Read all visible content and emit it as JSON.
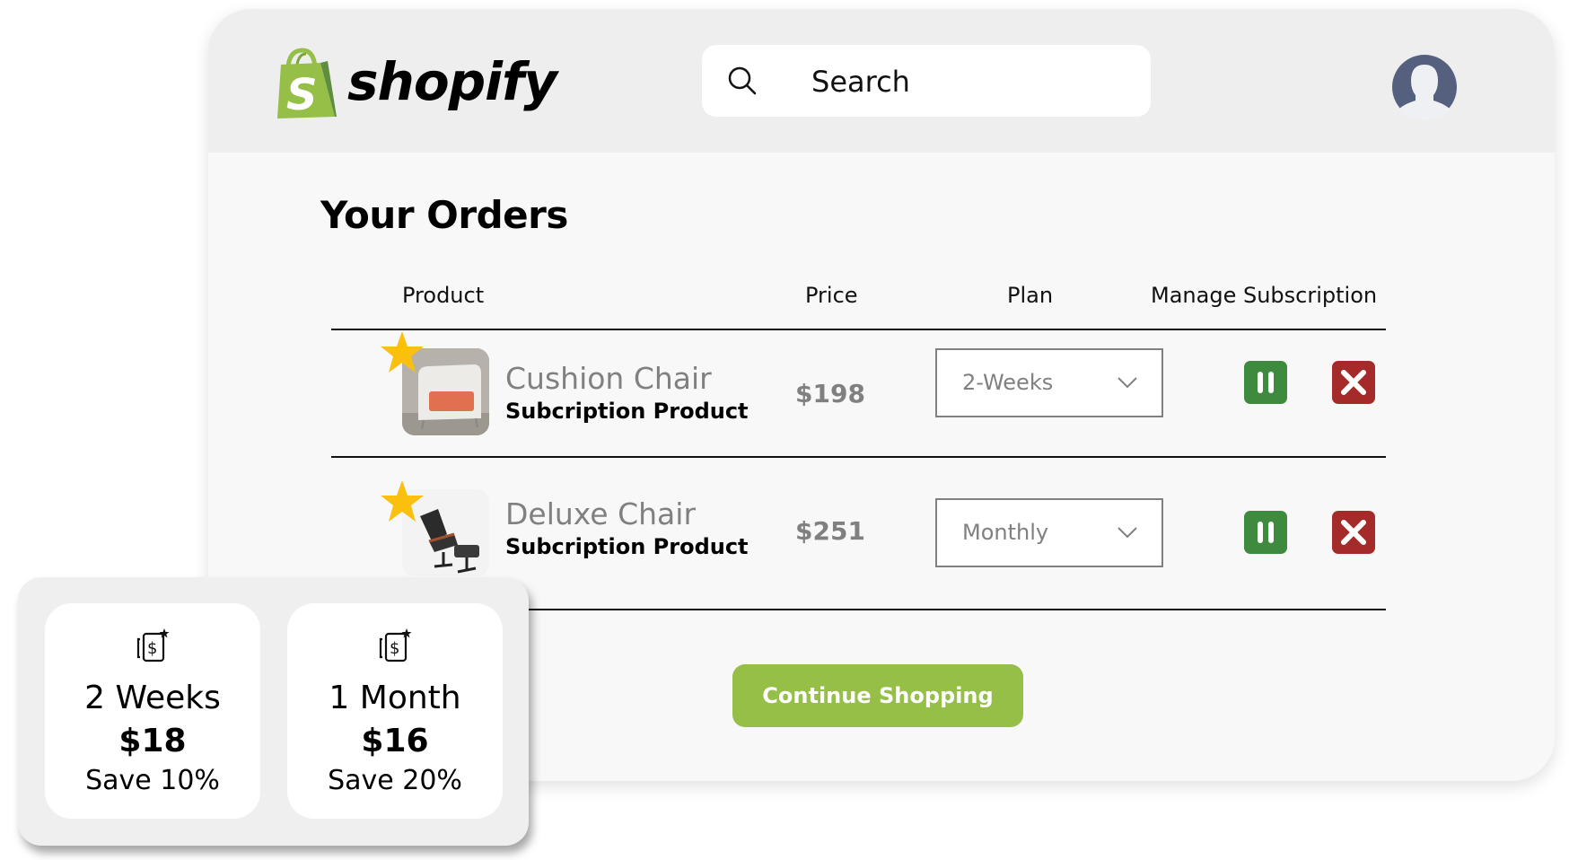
{
  "header": {
    "brand": "shopify",
    "brand_color": "#95bf47",
    "search": {
      "placeholder": "Search",
      "value": ""
    },
    "avatar_icon": "user-avatar-icon"
  },
  "orders": {
    "title": "Your Orders",
    "columns": [
      "Product",
      "Price",
      "Plan",
      "Manage Subscription"
    ],
    "rows": [
      {
        "name": "Cushion Chair",
        "subtitle": "Subcription Product",
        "price": "$198",
        "plan": "2-Weeks",
        "starred": true
      },
      {
        "name": "Deluxe Chair",
        "subtitle": "Subcription Product",
        "price": "$251",
        "plan": "Monthly",
        "starred": true
      }
    ],
    "actions": {
      "pause_icon": "pause-icon",
      "cancel_icon": "close-icon",
      "pause_color": "#3e8a3e",
      "cancel_color": "#a52a2a"
    },
    "continue_label": "Continue Shopping"
  },
  "plans": [
    {
      "icon": "subscription-dollar-icon",
      "period": "2 Weeks",
      "price": "$18",
      "save": "Save 10%"
    },
    {
      "icon": "subscription-dollar-icon",
      "period": "1 Month",
      "price": "$16",
      "save": "Save 20%"
    }
  ]
}
